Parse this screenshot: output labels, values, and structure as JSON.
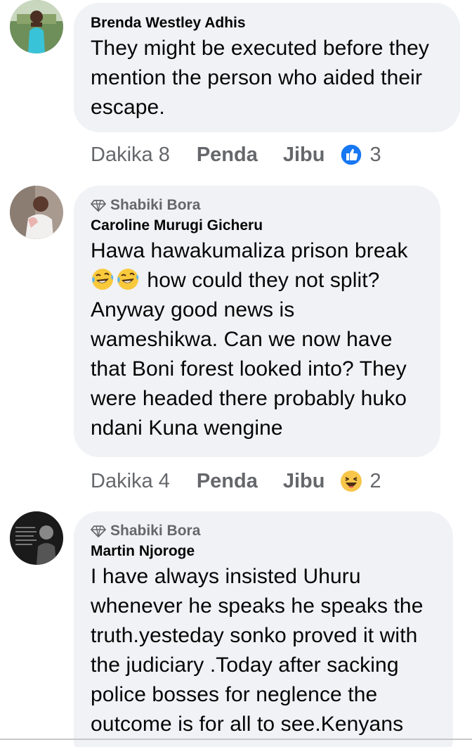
{
  "comments": [
    {
      "badge": "",
      "author": "Brenda Westley Adhis",
      "lines": [
        "They might be executed before they",
        "mention the person who aided their",
        "escape."
      ],
      "time": "Dakika 8",
      "like_label": "Penda",
      "reply_label": "Jibu",
      "reaction": {
        "icon": "like-thumb-icon",
        "count": "3"
      },
      "avatar_icon": "avatar-photo"
    },
    {
      "badge": "Shabiki Bora",
      "author": "Caroline Murugi Gicheru",
      "line1": "Hawa hawakumaliza prison break",
      "line2_text": " how could they not split?",
      "line2_emojis": [
        "laughing-tears-emoji",
        "laughing-tears-emoji"
      ],
      "lines_rest": [
        "Anyway good news is",
        "wameshikwa. Can we now have",
        "that Boni forest looked into? They",
        "were headed there probably huko",
        "ndani Kuna wengine"
      ],
      "time": "Dakika 4",
      "like_label": "Penda",
      "reply_label": "Jibu",
      "reaction": {
        "icon": "haha-emoji-icon",
        "count": "2"
      },
      "avatar_icon": "avatar-photo"
    },
    {
      "badge": "Shabiki Bora",
      "author": "Martin Njoroge",
      "lines": [
        "I have always insisted Uhuru",
        "whenever he speaks he speaks the",
        "truth.yesteday sonko proved it with",
        "the judiciary .Today after sacking",
        "police bosses for neglence the",
        "outcome is for all to see.Kenyans"
      ],
      "avatar_icon": "avatar-photo"
    }
  ],
  "colors": {
    "bubble": "#f0f2f5",
    "meta_text": "#65676b",
    "like_blue": "#1877f2",
    "haha_yellow": "#f7c64a"
  }
}
